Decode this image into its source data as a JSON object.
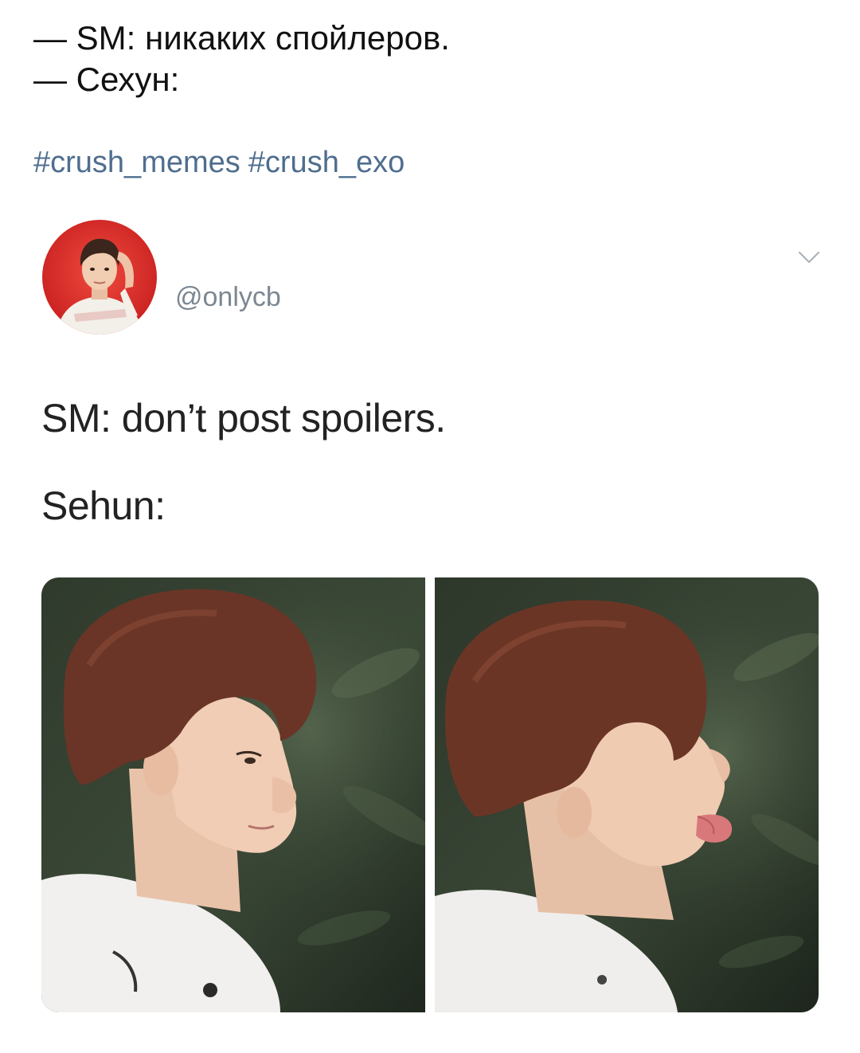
{
  "caption": {
    "line1": "— SM: никаких спойлеров.",
    "line2": "— Сехун:"
  },
  "hashtags": [
    "#crush_memes",
    "#crush_exo"
  ],
  "tweet": {
    "handle": "@onlycb",
    "text_line1": "SM: don’t post spoilers.",
    "text_line2": "Sehun:",
    "avatar": {
      "icon": "profile-photo",
      "ring_color": "#d92b2b"
    },
    "menu_icon": "chevron-down-icon",
    "media": [
      {
        "icon": "photo-profile-neutral"
      },
      {
        "icon": "photo-profile-tongue-out"
      }
    ]
  },
  "colors": {
    "hashtag": "#4f6e8f",
    "handle": "#7c8792",
    "text": "#222222"
  }
}
